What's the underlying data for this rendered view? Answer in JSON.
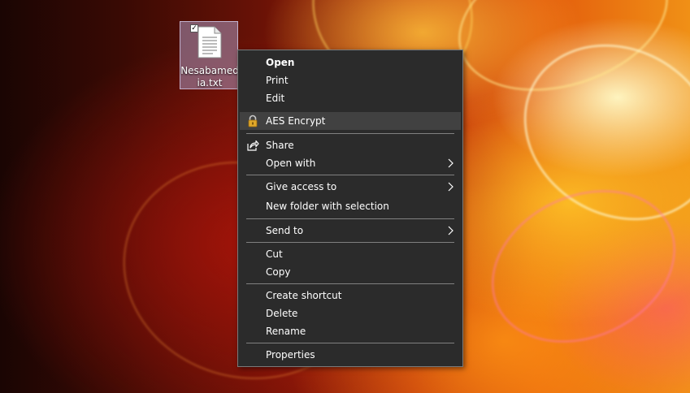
{
  "desktop": {
    "file_label": "Nesabamedia.txt",
    "file_checked_glyph": "✓",
    "file_icon": "text-file-icon"
  },
  "context_menu": {
    "items": [
      {
        "label": "Open",
        "bold": true
      },
      {
        "label": "Print"
      },
      {
        "label": "Edit"
      },
      {
        "label": "AES Encrypt",
        "icon": "lock-icon",
        "highlighted": true
      },
      {
        "label": "Share",
        "icon": "share-icon"
      },
      {
        "label": "Open with",
        "submenu": true
      },
      {
        "label": "Give access to",
        "submenu": true
      },
      {
        "label": "New folder with selection"
      },
      {
        "label": "Send to",
        "submenu": true
      },
      {
        "label": "Cut"
      },
      {
        "label": "Copy"
      },
      {
        "label": "Create shortcut"
      },
      {
        "label": "Delete"
      },
      {
        "label": "Rename"
      },
      {
        "label": "Properties"
      }
    ]
  },
  "colors": {
    "menu_background": "#2b2b2b",
    "menu_highlight": "#414141",
    "menu_text": "#ffffff",
    "separator": "#808080",
    "selection_fill": "#aa96be"
  }
}
